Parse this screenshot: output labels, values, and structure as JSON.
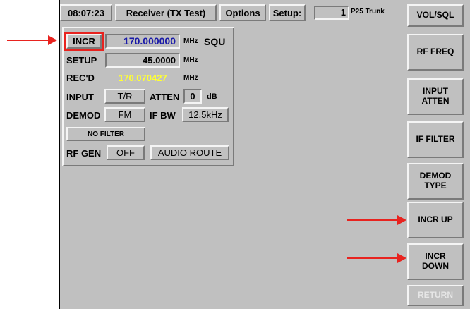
{
  "header": {
    "time": "08:07:23",
    "mode_title": "Receiver (TX Test)",
    "options_label": "Options",
    "setup_label": "Setup:",
    "setup_number": "1",
    "setup_name": "P25 Trunk"
  },
  "panel": {
    "incr_label": "INCR",
    "incr_value": "170.000000",
    "incr_unit": "MHz",
    "squelch_label": "SQU",
    "setup_label": "SETUP",
    "setup_value": "45.0000",
    "setup_unit": "MHz",
    "recd_label": "REC'D",
    "recd_value": "170.070427",
    "recd_unit": "MHz",
    "input_label": "INPUT",
    "input_value": "T/R",
    "atten_label": "ATTEN",
    "atten_value": "0",
    "atten_unit": "dB",
    "demod_label": "DEMOD",
    "demod_value": "FM",
    "ifbw_label": "IF BW",
    "ifbw_value": "12.5kHz",
    "filter_value": "NO FILTER",
    "rfgen_label": "RF GEN",
    "rfgen_value": "OFF",
    "audio_route_label": "AUDIO ROUTE"
  },
  "softkeys": {
    "vol_sql": "VOL/SQL",
    "rf_freq": "RF FREQ",
    "input_atten_1": "INPUT",
    "input_atten_2": "ATTEN",
    "if_filter": "IF FILTER",
    "demod_type_1": "DEMOD",
    "demod_type_2": "TYPE",
    "incr_up": "INCR UP",
    "incr_down_1": "INCR",
    "incr_down_2": "DOWN",
    "return": "RETURN"
  },
  "colors": {
    "incr_value": "#1a1aa8",
    "recd_value": "#ffff33",
    "highlight": "#e8231f",
    "background": "#c0c0c0"
  }
}
